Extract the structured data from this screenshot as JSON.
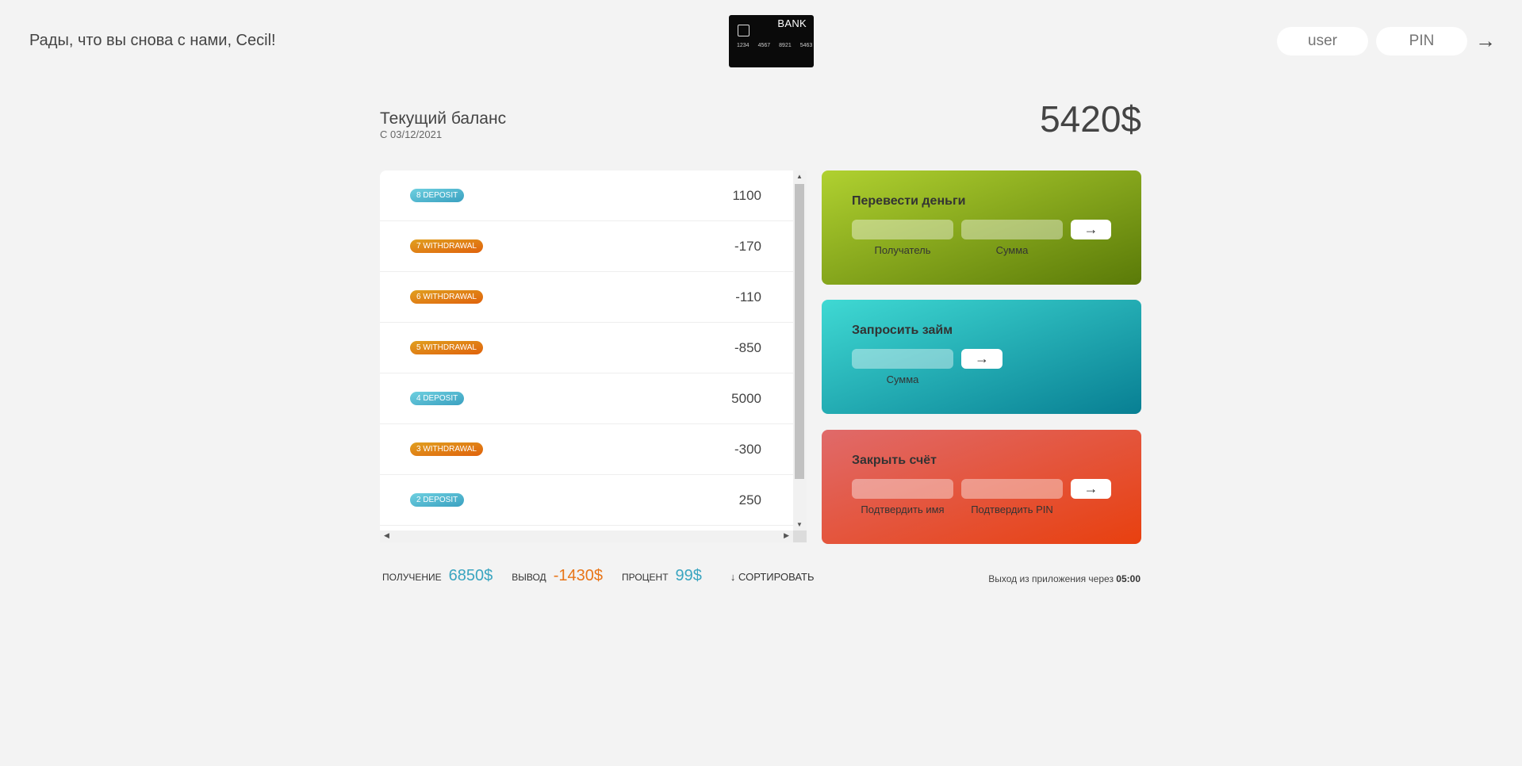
{
  "header": {
    "welcome": "Рады, что вы снова с нами, Cecil!",
    "logo": {
      "bank": "BANK",
      "numbers": [
        "1234",
        "4567",
        "8921",
        "5463"
      ]
    },
    "login": {
      "user_placeholder": "user",
      "pin_placeholder": "PIN",
      "submit": "→"
    }
  },
  "balance": {
    "label": "Текущий баланс",
    "date": "С 03/12/2021",
    "value": "5420$"
  },
  "movements": [
    {
      "type": "deposit",
      "badge": "8 DEPOSIT",
      "value": "1100"
    },
    {
      "type": "withdrawal",
      "badge": "7 WITHDRAWAL",
      "value": "-170"
    },
    {
      "type": "withdrawal",
      "badge": "6 WITHDRAWAL",
      "value": "-110"
    },
    {
      "type": "withdrawal",
      "badge": "5 WITHDRAWAL",
      "value": "-850"
    },
    {
      "type": "deposit",
      "badge": "4 DEPOSIT",
      "value": "5000"
    },
    {
      "type": "withdrawal",
      "badge": "3 WITHDRAWAL",
      "value": "-300"
    },
    {
      "type": "deposit",
      "badge": "2 DEPOSIT",
      "value": "250"
    }
  ],
  "operations": {
    "transfer": {
      "title": "Перевести деньги",
      "label_to": "Получатель",
      "label_amount": "Сумма",
      "submit": "→"
    },
    "loan": {
      "title": "Запросить займ",
      "label_amount": "Сумма",
      "submit": "→"
    },
    "close": {
      "title": "Закрыть счёт",
      "label_user": "Подтвердить имя",
      "label_pin": "Подтвердить PIN",
      "submit": "→"
    }
  },
  "summary": {
    "in_label": "ПОЛУЧЕНИЕ",
    "in_value": "6850$",
    "out_label": "ВЫВОД",
    "out_value": "-1430$",
    "interest_label": "ПРОЦЕНТ",
    "interest_value": "99$",
    "sort": "↓ СОРТИРОВАТЬ"
  },
  "timer": {
    "text": "Выход из приложения через",
    "value": "05:00"
  },
  "colors": {
    "deposit": "#3aa5c0",
    "withdrawal": "#e87518",
    "background": "#f3f3f3"
  }
}
